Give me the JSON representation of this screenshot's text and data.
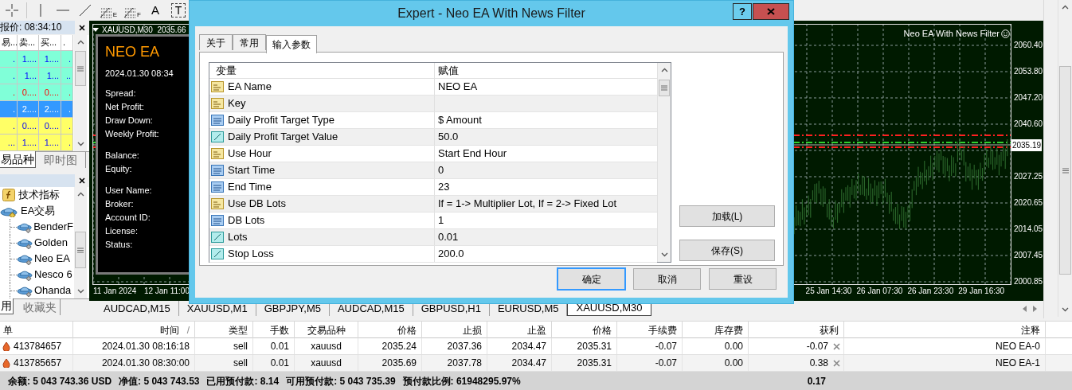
{
  "toolbar": {
    "tools": [
      {
        "kind": "crosshair"
      },
      {
        "kind": "vline"
      },
      {
        "kind": "hline"
      },
      {
        "kind": "trendline"
      },
      {
        "kind": "fibo",
        "label": "E"
      },
      {
        "kind": "fibo",
        "label": "F"
      },
      {
        "kind": "text",
        "label": "A"
      },
      {
        "kind": "label",
        "label": "T"
      }
    ]
  },
  "market_watch": {
    "title": "报价: 08:34:10",
    "columns": [
      "易...",
      "卖...",
      "买...",
      "."
    ],
    "rows": [
      {
        "cells": [
          ".",
          "1....",
          "1....",
          "."
        ],
        "color": "#80ffd8",
        "kind": "up",
        "selected": false
      },
      {
        "cells": [
          ".",
          "1...",
          "1...",
          ".."
        ],
        "color": "#80ffd8",
        "kind": "up",
        "selected": false
      },
      {
        "cells": [
          ".",
          "0....",
          "0....",
          "."
        ],
        "color": "#80ffd8",
        "kind": "down",
        "selected": false
      },
      {
        "cells": [
          ".",
          "2....",
          "2....",
          "."
        ],
        "color": "#3399ff",
        "selected": true
      },
      {
        "cells": [
          ".",
          "0....",
          "0....",
          "."
        ],
        "color": "#ffff66",
        "kind": "up",
        "selected": false
      },
      {
        "cells": [
          "...",
          "1....",
          "1....",
          "."
        ],
        "color": "#ffff66",
        "kind": "up",
        "selected": false
      }
    ],
    "tabs": [
      {
        "label": "易品种",
        "selected": true
      },
      {
        "label": "即时图",
        "selected": false
      }
    ]
  },
  "navigator": {
    "items": [
      {
        "label": "技术指标",
        "kind": "indicators"
      },
      {
        "label": "EA交易",
        "kind": "experts",
        "children": [
          {
            "label": "BenderF",
            "kind": "expert"
          },
          {
            "label": "Golden",
            "kind": "expert"
          },
          {
            "label": "Neo EA",
            "kind": "expert"
          },
          {
            "label": "Nesco 6",
            "kind": "expert"
          },
          {
            "label": "Ohanda",
            "kind": "expert"
          }
        ]
      }
    ],
    "tabs": [
      {
        "label": "用",
        "selected": true
      },
      {
        "label": "收藏夹",
        "selected": false
      }
    ]
  },
  "chart": {
    "symbol": "XAUUSD,M30  2035.66",
    "indicator_name": "Neo EA With News Filter",
    "price_axis": [
      "2060.40",
      "2053.80",
      "2047.20",
      "2040.60",
      "2027.25",
      "2020.65",
      "2014.05",
      "2007.45",
      "2000.85"
    ],
    "current_price": "2035.19",
    "time_axis": [
      "11 Jan 2024",
      "12 Jan 11:00",
      "25 Jan 14:30",
      "26 Jan 07:30",
      "26 Jan 23:30",
      "29 Jan 16:30"
    ],
    "ea_panel": {
      "title": "NEO EA",
      "datetime": "2024.01.30 08:34",
      "groups": [
        [
          "Spread:",
          "Net Profit:",
          "Draw Down:",
          "Weekly Profit:"
        ],
        [
          "Balance:",
          "Equity:"
        ],
        [
          "User Name:",
          "Broker:",
          "Account ID:",
          "License:",
          "Status:"
        ]
      ]
    }
  },
  "chart_tabs": [
    {
      "label": "AUDCAD,M15",
      "selected": false
    },
    {
      "label": "XAUUSD,M1",
      "selected": false
    },
    {
      "label": "GBPJPY,M5",
      "selected": false
    },
    {
      "label": "AUDCAD,M15",
      "selected": false
    },
    {
      "label": "GBPUSD,H1",
      "selected": false
    },
    {
      "label": "EURUSD,M5",
      "selected": false
    },
    {
      "label": "XAUUSD,M30",
      "selected": true
    }
  ],
  "dialog": {
    "title": "Expert - Neo EA With News Filter",
    "help_button": "?",
    "tabs": [
      {
        "label": "关于",
        "selected": false
      },
      {
        "label": "常用",
        "selected": false
      },
      {
        "label": "输入参数",
        "selected": true
      }
    ],
    "columns": [
      "变量",
      "赋值"
    ],
    "parameters": [
      {
        "kind": "text",
        "name": "EA Name",
        "value": "NEO EA"
      },
      {
        "kind": "text",
        "name": "Key"
      },
      {
        "kind": "int",
        "name": "Daily Profit Target Type",
        "value": "$ Amount"
      },
      {
        "kind": "float",
        "name": "Daily Profit Target Value",
        "value": "50.0"
      },
      {
        "kind": "text",
        "name": "Use Hour",
        "value": "Start End Hour"
      },
      {
        "kind": "int",
        "name": "Start Time",
        "value": "0"
      },
      {
        "kind": "int",
        "name": "End Time",
        "value": "23"
      },
      {
        "kind": "text",
        "name": "Use DB Lots",
        "value": "If = 1-> Multiplier Lot, If = 2-> Fixed Lot"
      },
      {
        "kind": "int",
        "name": "DB Lots",
        "value": "1"
      },
      {
        "kind": "float",
        "name": "Lots",
        "value": "0.01"
      },
      {
        "kind": "float",
        "name": "Stop Loss",
        "value": "200.0"
      }
    ],
    "side_buttons": [
      "加载(L)",
      "保存(S)"
    ],
    "buttons": [
      {
        "label": "确定",
        "default": true
      },
      {
        "label": "取消",
        "default": false
      },
      {
        "label": "重设",
        "default": false
      }
    ]
  },
  "terminal": {
    "columns": [
      {
        "label": "单"
      },
      {
        "label": "时间",
        "sort_mark": "/"
      },
      {
        "label": "类型"
      },
      {
        "label": "手数"
      },
      {
        "label": "交易品种"
      },
      {
        "label": "价格"
      },
      {
        "label": "止损"
      },
      {
        "label": "止盈"
      },
      {
        "label": "价格"
      },
      {
        "label": "手续费"
      },
      {
        "label": "库存费"
      },
      {
        "label": "获利"
      },
      {
        "label": "注释"
      }
    ],
    "rows": [
      {
        "cells": [
          "413784657",
          "2024.01.30 08:16:18",
          "sell",
          "0.01",
          "xauusd",
          "2035.24",
          "2037.36",
          "2034.47",
          "2035.31",
          "-0.07",
          "0.00",
          "-0.07",
          "NEO EA-0"
        ]
      },
      {
        "cells": [
          "413785657",
          "2024.01.30 08:30:00",
          "sell",
          "0.01",
          "xauusd",
          "2035.69",
          "2037.78",
          "2034.47",
          "2035.31",
          "-0.07",
          "0.00",
          "0.38",
          "NEO EA-1"
        ]
      }
    ],
    "summary": [
      "余额: 5 043 743.36 USD",
      "净值: 5 043 743.53",
      "已用预付款: 8.14",
      "可用预付款: 5 043 735.39",
      "预付款比例: 61948295.97%"
    ],
    "summary_profit": "0.17"
  }
}
